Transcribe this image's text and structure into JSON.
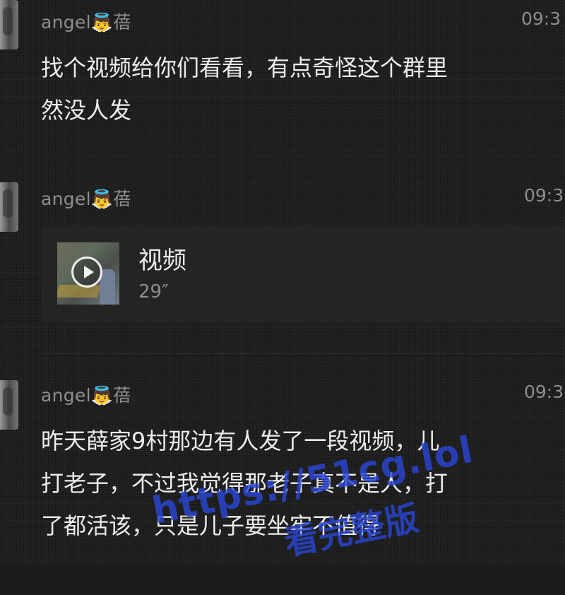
{
  "messages": [
    {
      "sender": "angel👼蓓",
      "time": "09:3",
      "lines": [
        "找个视频给你们看看，有点奇怪这个群里",
        "然没人发"
      ]
    },
    {
      "sender": "angel👼蓓",
      "time": "09:3",
      "video": {
        "title": "视频",
        "duration": "29″"
      }
    },
    {
      "sender": "angel👼蓓",
      "time": "09:3",
      "lines": [
        "昨天薛家9村那边有人发了一段视频，儿",
        "打老子，不过我觉得那老子真不是人，打",
        "了都活该，只是儿子要坐牢不值得"
      ]
    }
  ],
  "watermark": {
    "url": "https://51cg.lol",
    "subtitle": "看完整版"
  },
  "colors": {
    "background": "#1c1c1c",
    "meta_text": "#8e8e8e",
    "body_text": "#ececec",
    "watermark": "#2846d2"
  },
  "icons": {
    "avatar": "avatar-image",
    "play": "play-icon"
  }
}
